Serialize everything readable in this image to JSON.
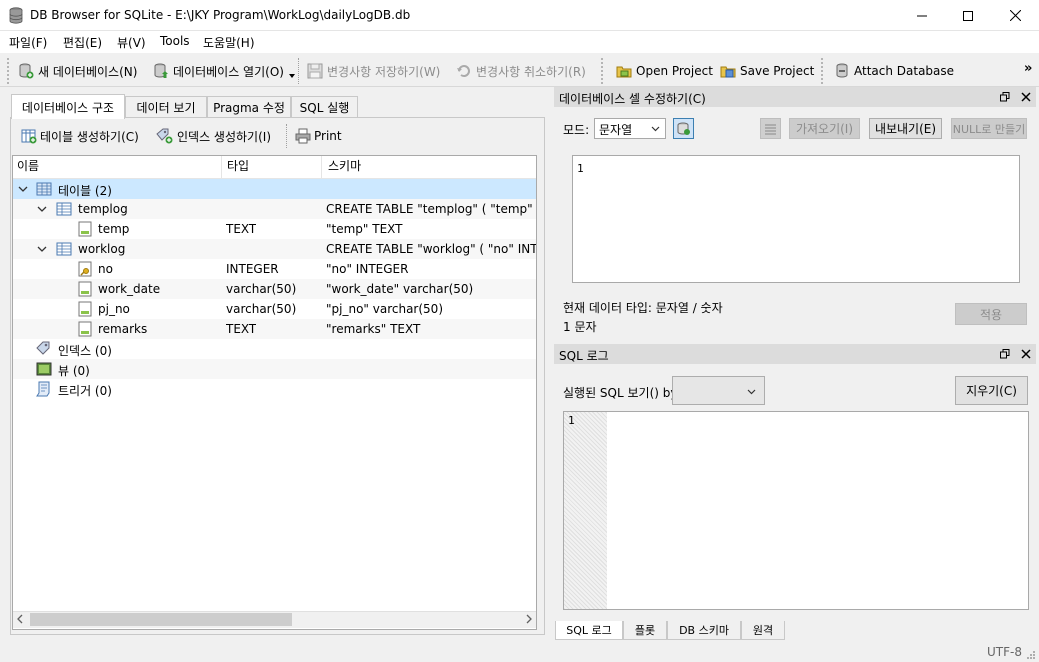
{
  "window": {
    "title": "DB Browser for SQLite - E:\\JKY Program\\WorkLog\\dailyLogDB.db"
  },
  "menu": [
    "파일(F)",
    "편집(E)",
    "뷰(V)",
    "Tools",
    "도움말(H)"
  ],
  "toolbar": {
    "new_db": "새 데이터베이스(N)",
    "open_db": "데이터베이스 열기(O)",
    "write_changes": "변경사항 저장하기(W)",
    "revert_changes": "변경사항 취소하기(R)",
    "open_project": "Open Project",
    "save_project": "Save Project",
    "attach_db": "Attach Database",
    "overflow": "»"
  },
  "left_tabs": [
    "데이터베이스 구조",
    "데이터 보기",
    "Pragma 수정",
    "SQL 실행"
  ],
  "structure_toolbar": {
    "create_table": "테이블 생성하기(C)",
    "create_index": "인덱스 생성하기(I)",
    "print": "Print"
  },
  "tree": {
    "columns": [
      "이름",
      "타입",
      "스키마"
    ],
    "rows": [
      {
        "name": "테이블 (2)",
        "type": "",
        "schema": ""
      },
      {
        "name": "templog",
        "type": "",
        "schema": "CREATE TABLE \"templog\" ( \"temp\" TEXT"
      },
      {
        "name": "temp",
        "type": "TEXT",
        "schema": "\"temp\" TEXT"
      },
      {
        "name": "worklog",
        "type": "",
        "schema": "CREATE TABLE \"worklog\" ( \"no\" INTEGER"
      },
      {
        "name": "no",
        "type": "INTEGER",
        "schema": "\"no\" INTEGER"
      },
      {
        "name": "work_date",
        "type": "varchar(50)",
        "schema": "\"work_date\" varchar(50)"
      },
      {
        "name": "pj_no",
        "type": "varchar(50)",
        "schema": "\"pj_no\" varchar(50)"
      },
      {
        "name": "remarks",
        "type": "TEXT",
        "schema": "\"remarks\" TEXT"
      },
      {
        "name": "인덱스 (0)",
        "type": "",
        "schema": ""
      },
      {
        "name": "뷰 (0)",
        "type": "",
        "schema": ""
      },
      {
        "name": "트리거 (0)",
        "type": "",
        "schema": ""
      }
    ]
  },
  "cell_editor": {
    "title": "데이터베이스 셀 수정하기(C)",
    "mode_label": "모드:",
    "mode_value": "문자열",
    "import_btn": "가져오기(I)",
    "export_btn": "내보내기(E)",
    "null_btn": "NULL로 만들기",
    "editor_line_number": "1",
    "current_type": "현재 데이터 타입: 문자열 / 숫자",
    "size": "1 문자",
    "apply_btn": "적용"
  },
  "sql_log": {
    "title": "SQL 로그",
    "show_label": "실행된 SQL 보기() by",
    "clear_btn": "지우기(C)",
    "line_number": "1"
  },
  "bottom_tabs": [
    "SQL 로그",
    "플롯",
    "DB 스키마",
    "원격"
  ],
  "status": {
    "encoding": "UTF-8"
  }
}
